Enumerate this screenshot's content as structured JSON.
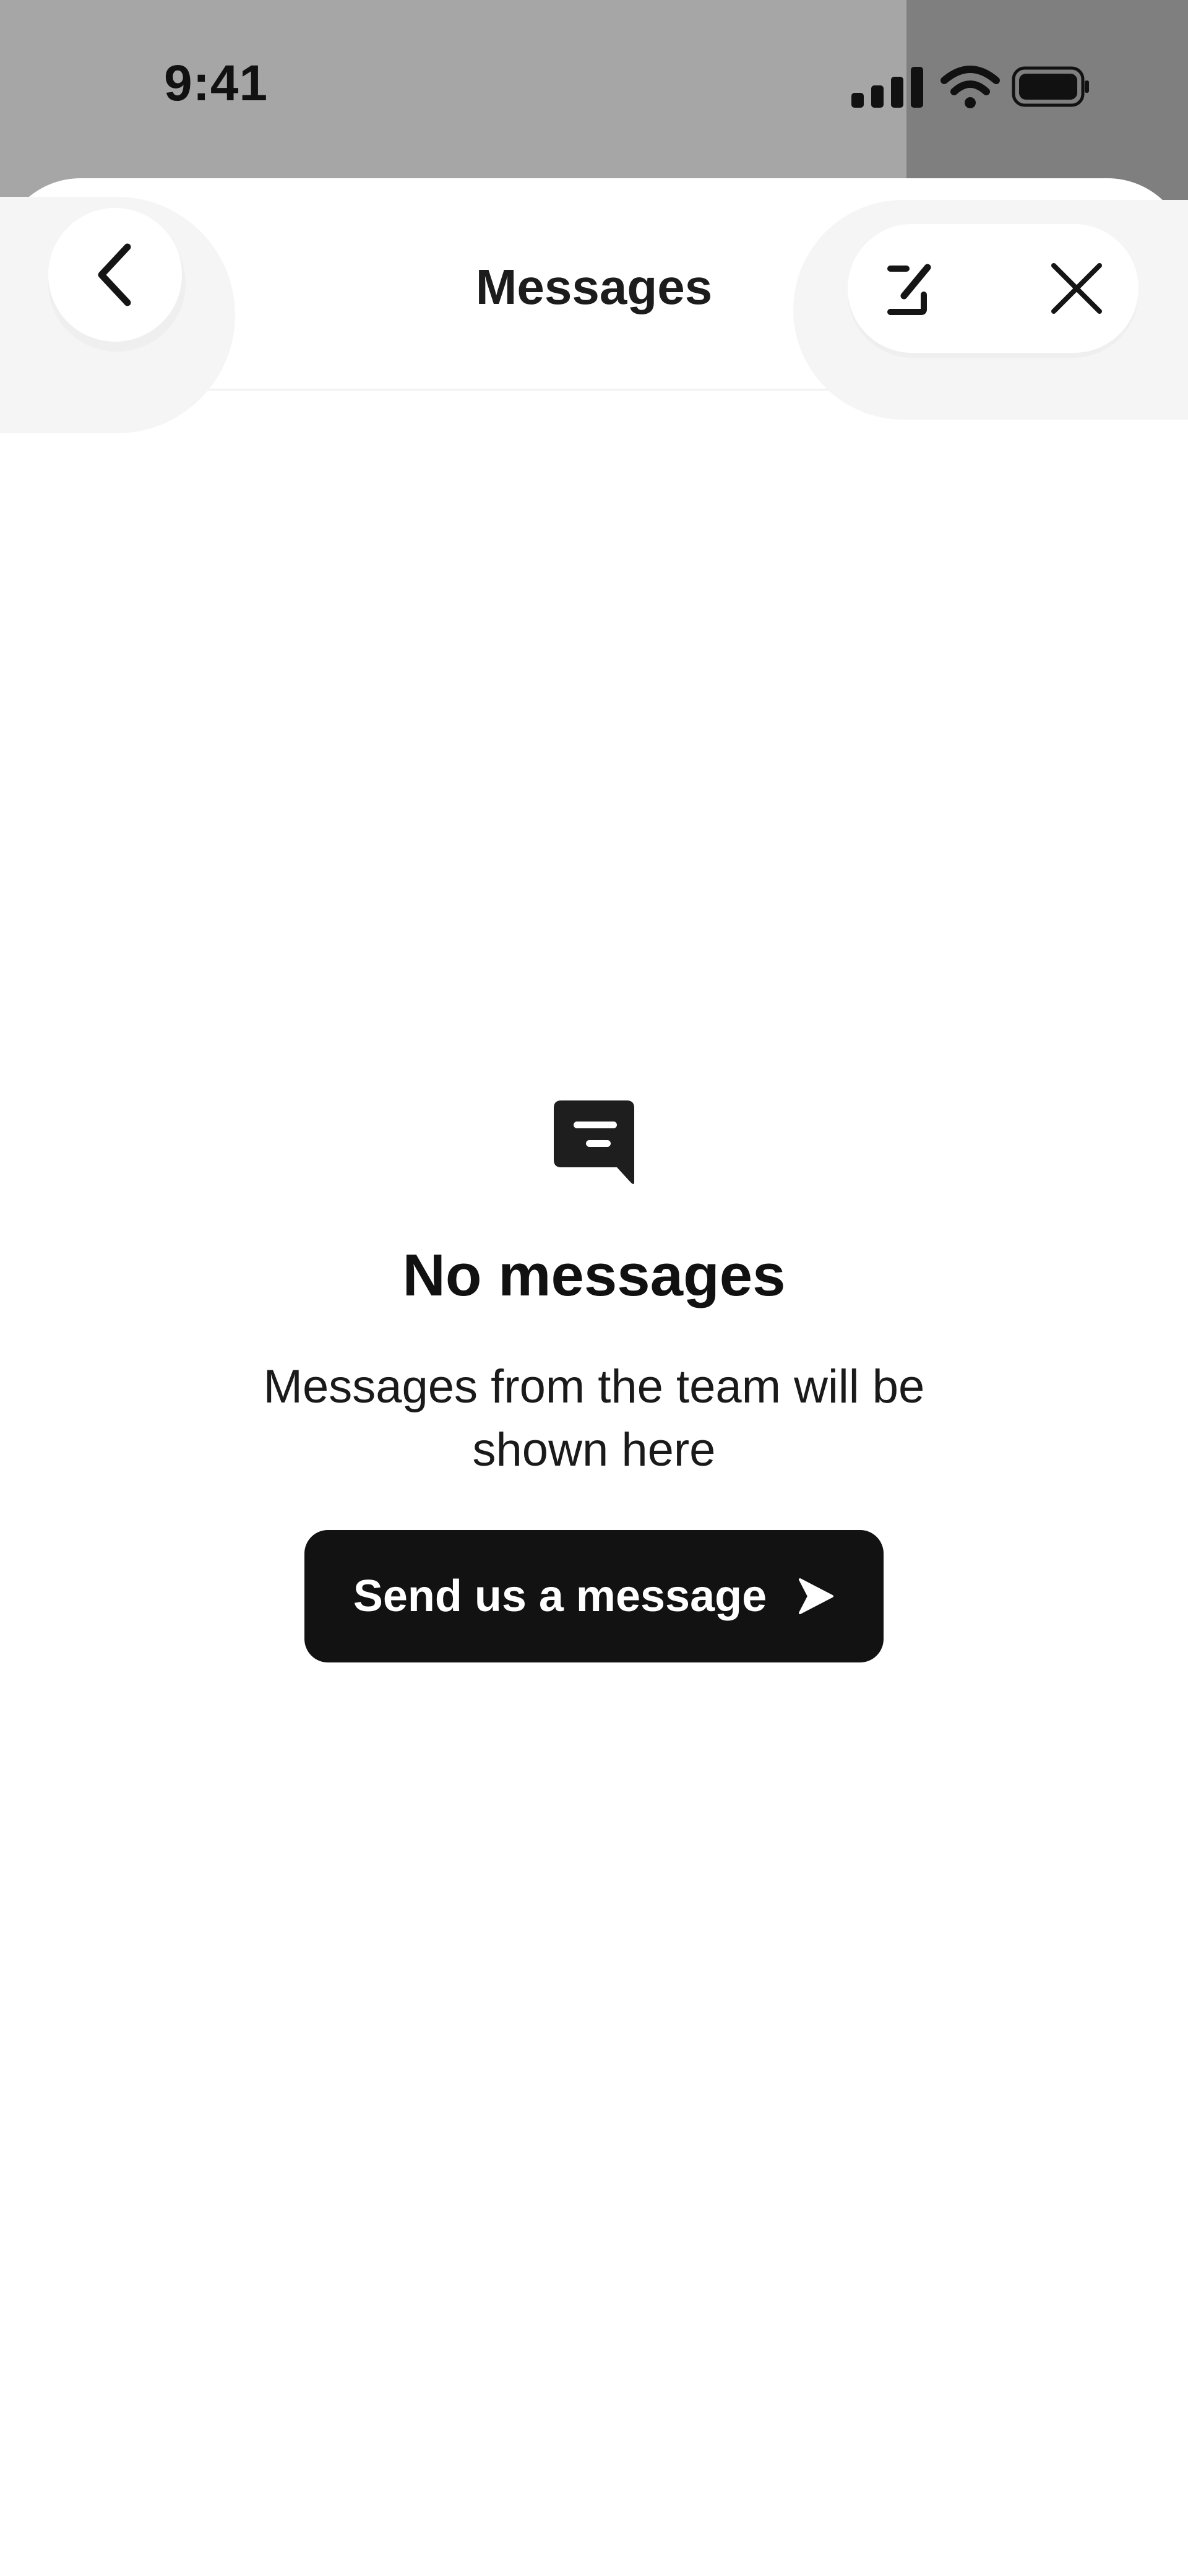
{
  "status_bar": {
    "time": "9:41",
    "icons": [
      "cellular-signal-icon",
      "wifi-icon",
      "battery-icon"
    ]
  },
  "header": {
    "title": "Messages",
    "back_icon": "chevron-left-icon",
    "compose_icon": "compose-icon",
    "close_icon": "close-icon"
  },
  "empty_state": {
    "icon": "message-bubble-icon",
    "title": "No messages",
    "description": "Messages from the team will be shown here",
    "button_label": "Send us a message",
    "button_icon": "send-arrow-icon"
  },
  "colors": {
    "status_backdrop": "#a6a6a6",
    "status_backdrop_dark": "#7f7f7f",
    "button_bg": "#121212",
    "text_primary": "#111111"
  }
}
